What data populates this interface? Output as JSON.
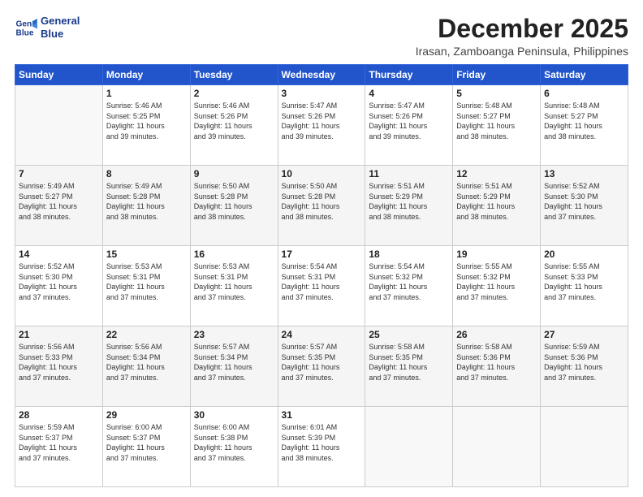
{
  "header": {
    "logo_line1": "General",
    "logo_line2": "Blue",
    "month_title": "December 2025",
    "subtitle": "Irasan, Zamboanga Peninsula, Philippines"
  },
  "days_of_week": [
    "Sunday",
    "Monday",
    "Tuesday",
    "Wednesday",
    "Thursday",
    "Friday",
    "Saturday"
  ],
  "weeks": [
    [
      {
        "day": "",
        "info": ""
      },
      {
        "day": "1",
        "info": "Sunrise: 5:46 AM\nSunset: 5:25 PM\nDaylight: 11 hours\nand 39 minutes."
      },
      {
        "day": "2",
        "info": "Sunrise: 5:46 AM\nSunset: 5:26 PM\nDaylight: 11 hours\nand 39 minutes."
      },
      {
        "day": "3",
        "info": "Sunrise: 5:47 AM\nSunset: 5:26 PM\nDaylight: 11 hours\nand 39 minutes."
      },
      {
        "day": "4",
        "info": "Sunrise: 5:47 AM\nSunset: 5:26 PM\nDaylight: 11 hours\nand 39 minutes."
      },
      {
        "day": "5",
        "info": "Sunrise: 5:48 AM\nSunset: 5:27 PM\nDaylight: 11 hours\nand 38 minutes."
      },
      {
        "day": "6",
        "info": "Sunrise: 5:48 AM\nSunset: 5:27 PM\nDaylight: 11 hours\nand 38 minutes."
      }
    ],
    [
      {
        "day": "7",
        "info": "Sunrise: 5:49 AM\nSunset: 5:27 PM\nDaylight: 11 hours\nand 38 minutes."
      },
      {
        "day": "8",
        "info": "Sunrise: 5:49 AM\nSunset: 5:28 PM\nDaylight: 11 hours\nand 38 minutes."
      },
      {
        "day": "9",
        "info": "Sunrise: 5:50 AM\nSunset: 5:28 PM\nDaylight: 11 hours\nand 38 minutes."
      },
      {
        "day": "10",
        "info": "Sunrise: 5:50 AM\nSunset: 5:28 PM\nDaylight: 11 hours\nand 38 minutes."
      },
      {
        "day": "11",
        "info": "Sunrise: 5:51 AM\nSunset: 5:29 PM\nDaylight: 11 hours\nand 38 minutes."
      },
      {
        "day": "12",
        "info": "Sunrise: 5:51 AM\nSunset: 5:29 PM\nDaylight: 11 hours\nand 38 minutes."
      },
      {
        "day": "13",
        "info": "Sunrise: 5:52 AM\nSunset: 5:30 PM\nDaylight: 11 hours\nand 37 minutes."
      }
    ],
    [
      {
        "day": "14",
        "info": "Sunrise: 5:52 AM\nSunset: 5:30 PM\nDaylight: 11 hours\nand 37 minutes."
      },
      {
        "day": "15",
        "info": "Sunrise: 5:53 AM\nSunset: 5:31 PM\nDaylight: 11 hours\nand 37 minutes."
      },
      {
        "day": "16",
        "info": "Sunrise: 5:53 AM\nSunset: 5:31 PM\nDaylight: 11 hours\nand 37 minutes."
      },
      {
        "day": "17",
        "info": "Sunrise: 5:54 AM\nSunset: 5:31 PM\nDaylight: 11 hours\nand 37 minutes."
      },
      {
        "day": "18",
        "info": "Sunrise: 5:54 AM\nSunset: 5:32 PM\nDaylight: 11 hours\nand 37 minutes."
      },
      {
        "day": "19",
        "info": "Sunrise: 5:55 AM\nSunset: 5:32 PM\nDaylight: 11 hours\nand 37 minutes."
      },
      {
        "day": "20",
        "info": "Sunrise: 5:55 AM\nSunset: 5:33 PM\nDaylight: 11 hours\nand 37 minutes."
      }
    ],
    [
      {
        "day": "21",
        "info": "Sunrise: 5:56 AM\nSunset: 5:33 PM\nDaylight: 11 hours\nand 37 minutes."
      },
      {
        "day": "22",
        "info": "Sunrise: 5:56 AM\nSunset: 5:34 PM\nDaylight: 11 hours\nand 37 minutes."
      },
      {
        "day": "23",
        "info": "Sunrise: 5:57 AM\nSunset: 5:34 PM\nDaylight: 11 hours\nand 37 minutes."
      },
      {
        "day": "24",
        "info": "Sunrise: 5:57 AM\nSunset: 5:35 PM\nDaylight: 11 hours\nand 37 minutes."
      },
      {
        "day": "25",
        "info": "Sunrise: 5:58 AM\nSunset: 5:35 PM\nDaylight: 11 hours\nand 37 minutes."
      },
      {
        "day": "26",
        "info": "Sunrise: 5:58 AM\nSunset: 5:36 PM\nDaylight: 11 hours\nand 37 minutes."
      },
      {
        "day": "27",
        "info": "Sunrise: 5:59 AM\nSunset: 5:36 PM\nDaylight: 11 hours\nand 37 minutes."
      }
    ],
    [
      {
        "day": "28",
        "info": "Sunrise: 5:59 AM\nSunset: 5:37 PM\nDaylight: 11 hours\nand 37 minutes."
      },
      {
        "day": "29",
        "info": "Sunrise: 6:00 AM\nSunset: 5:37 PM\nDaylight: 11 hours\nand 37 minutes."
      },
      {
        "day": "30",
        "info": "Sunrise: 6:00 AM\nSunset: 5:38 PM\nDaylight: 11 hours\nand 37 minutes."
      },
      {
        "day": "31",
        "info": "Sunrise: 6:01 AM\nSunset: 5:39 PM\nDaylight: 11 hours\nand 38 minutes."
      },
      {
        "day": "",
        "info": ""
      },
      {
        "day": "",
        "info": ""
      },
      {
        "day": "",
        "info": ""
      }
    ]
  ]
}
